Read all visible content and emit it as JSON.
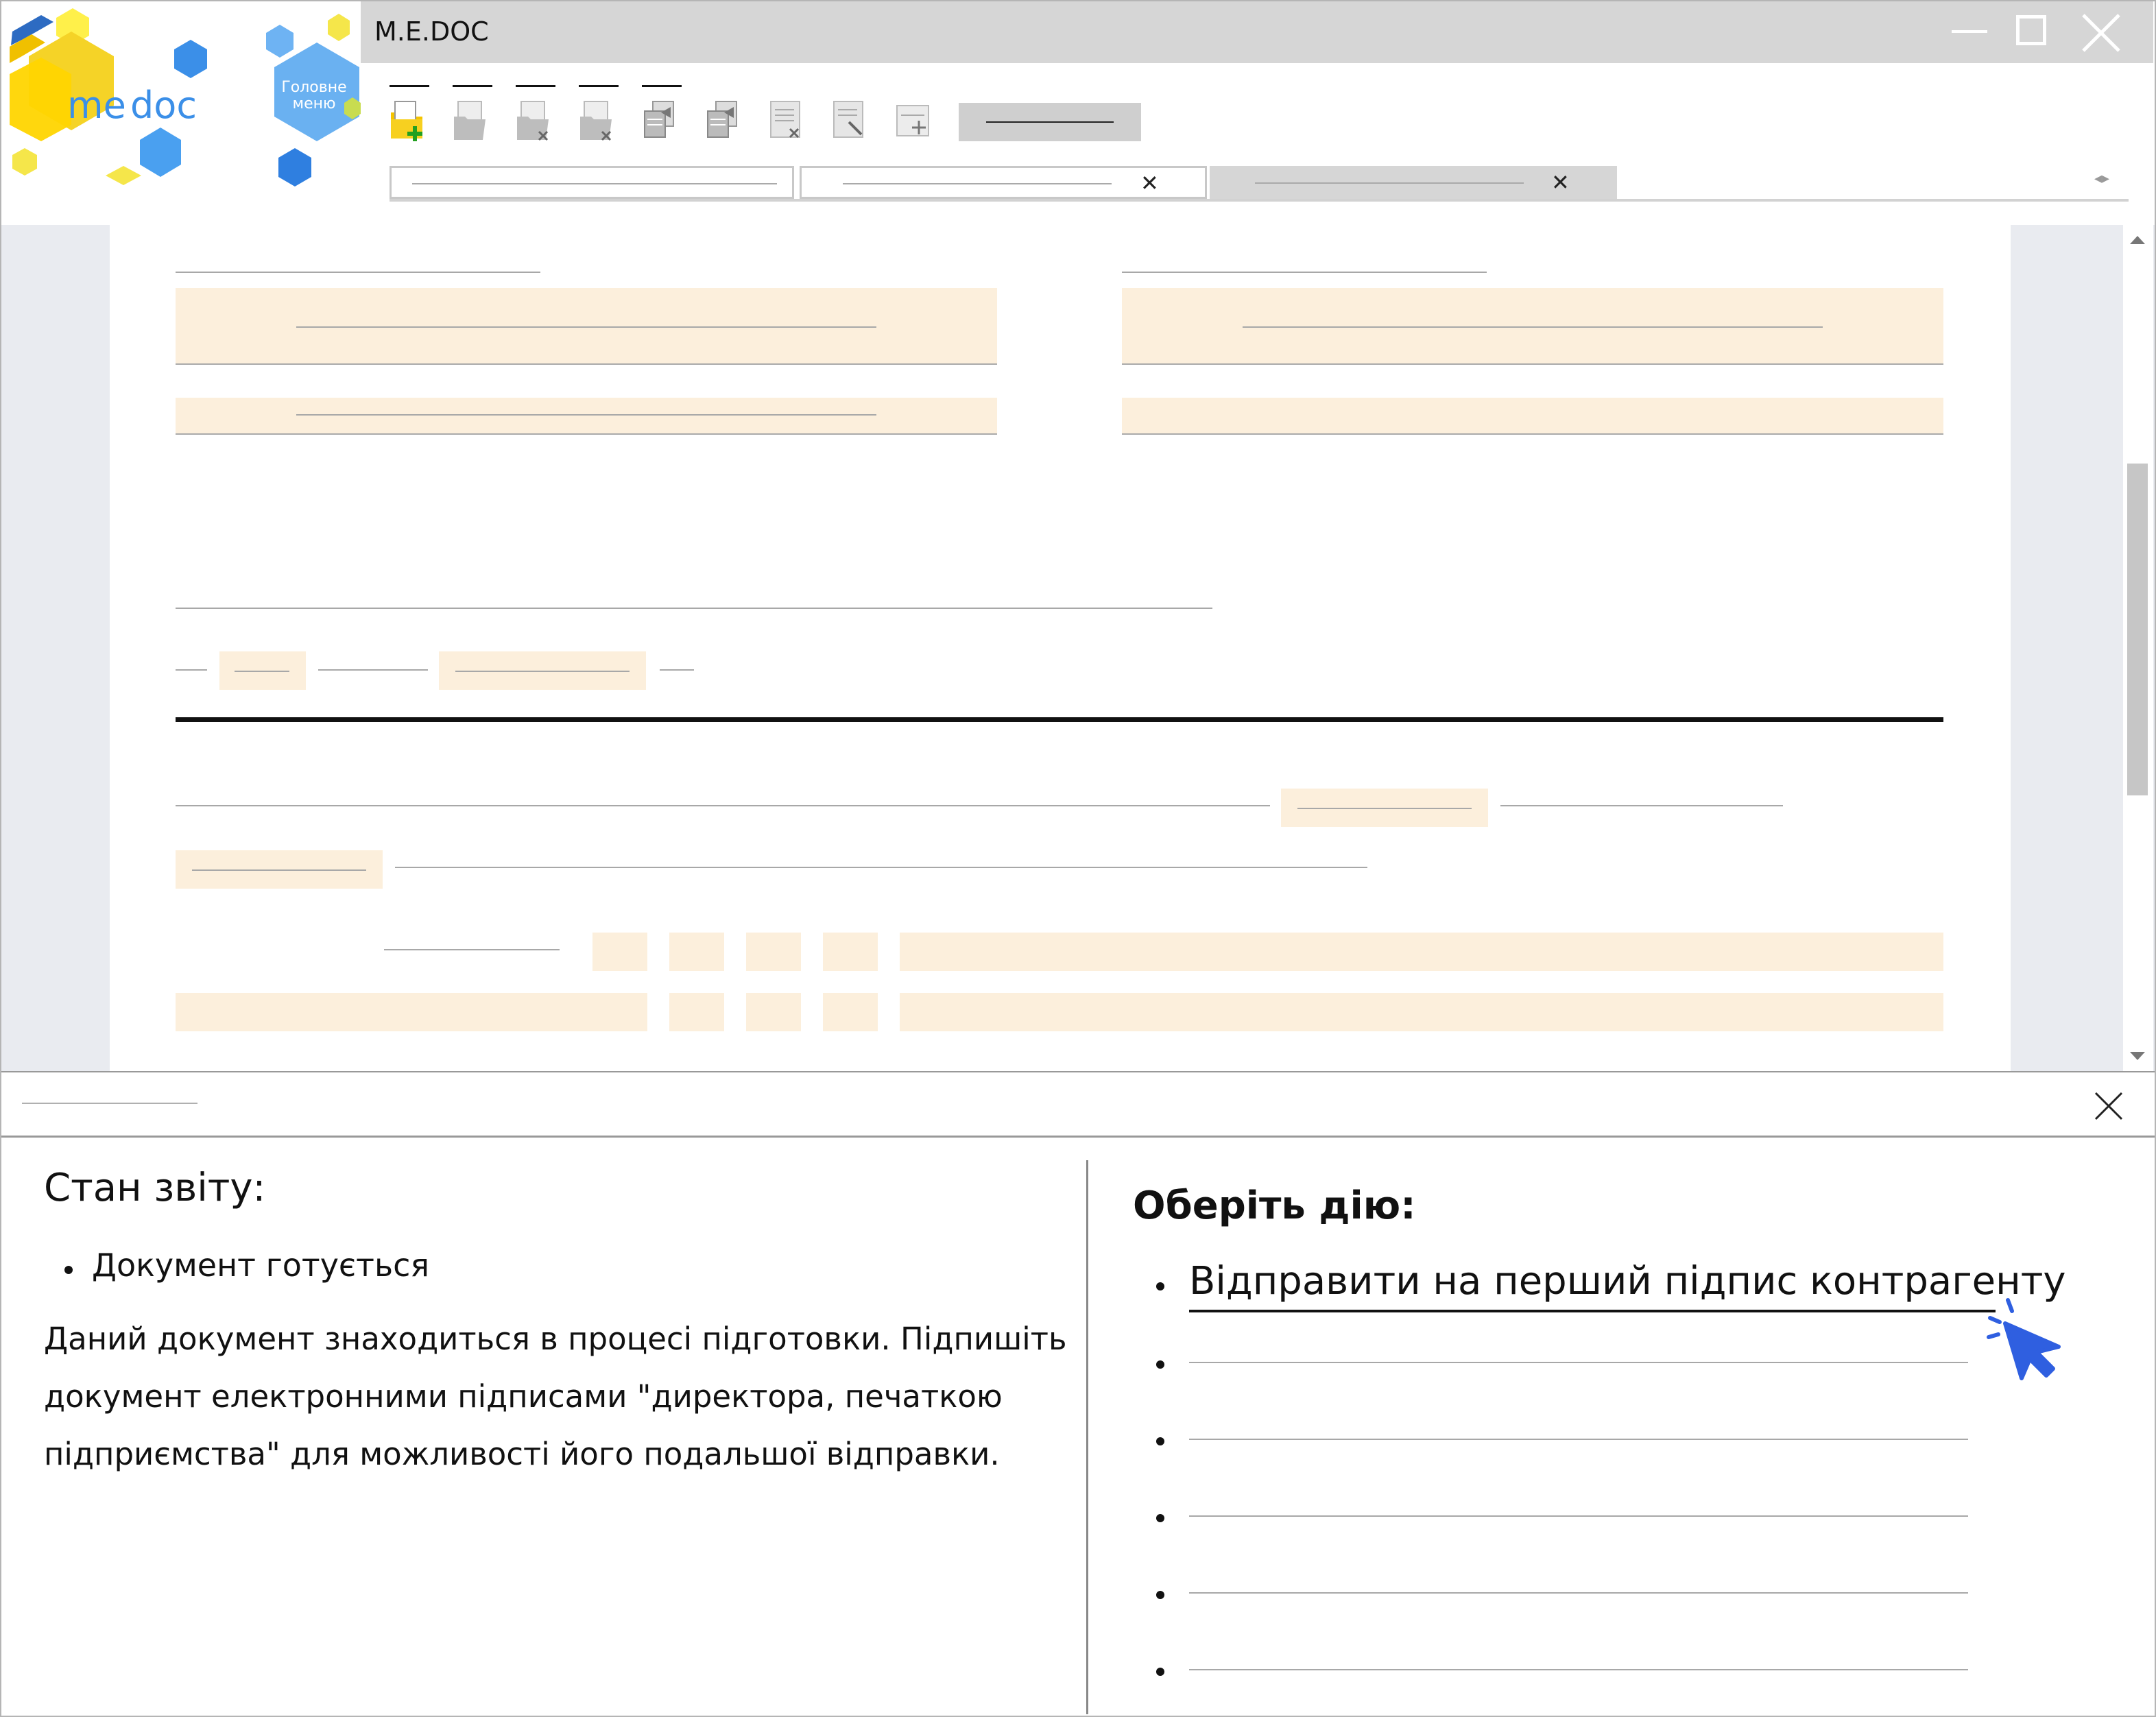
{
  "window": {
    "title": "M.E.DOC",
    "logo_text": "me doc",
    "main_menu_label": "Головне меню"
  },
  "status_panel": {
    "heading": "Стан звіту:",
    "items": [
      "Документ готується"
    ],
    "description_lines": [
      "Даний документ знаходиться в процесі підготовки. Підпишіть",
      "документ електронними підписами \"директора, печаткою",
      "підприємства\" для можливості його подальшої відправки."
    ]
  },
  "actions_panel": {
    "heading": "Оберіть дію:",
    "actions": [
      "Відправити на перший підпис контрагенту"
    ]
  },
  "colors": {
    "titlebar": "#d6d6d6",
    "field_fill": "#fcefdc",
    "cursor": "#2f5fe0",
    "logo_yellow": "#f5d327",
    "logo_blue": "#3a8fe0"
  },
  "icons": [
    "new-document-icon",
    "open-document-icon",
    "delete-document-icon",
    "delete-copy-icon",
    "copy-document-icon",
    "copy-document-2-icon",
    "clear-form-icon",
    "edit-form-icon",
    "add-form-icon",
    "minimize-icon",
    "maximize-icon",
    "close-icon",
    "tab-close-icon",
    "scroll-up-icon",
    "scroll-down-icon",
    "panel-close-icon",
    "cursor-click-icon"
  ]
}
